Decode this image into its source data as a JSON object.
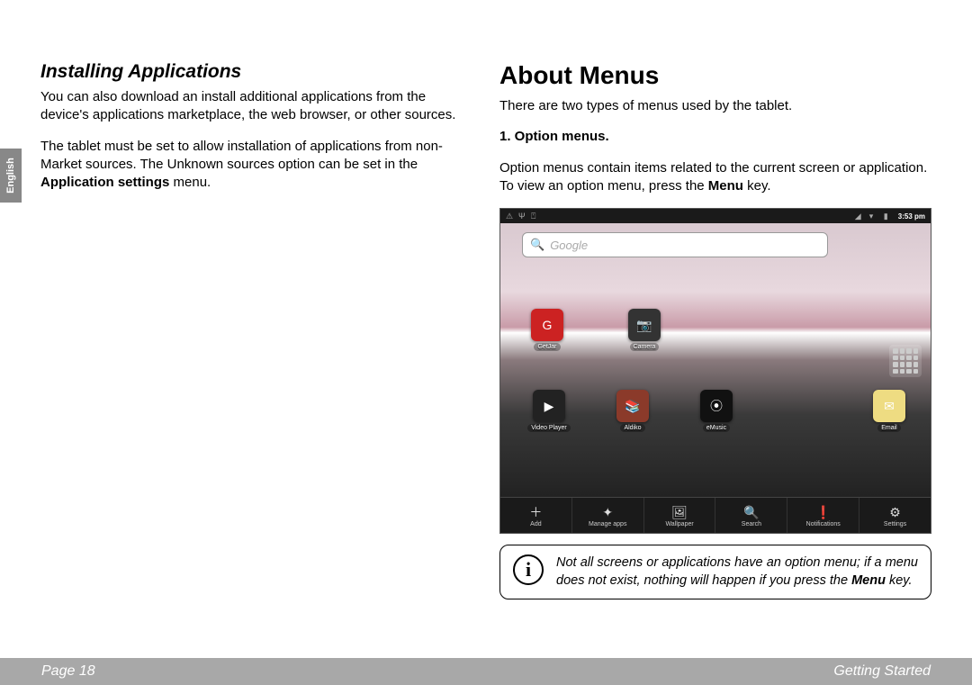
{
  "sideTab": "English",
  "left": {
    "heading": "Installing Applications",
    "p1": "You can also download an install additional applications from the device's applications marketplace, the web browser, or other sources.",
    "p2a": "The tablet must be set to allow installation of applications from non-Market sources. The Unknown sources option can be set in the ",
    "p2b": "Application settings",
    "p2c": " menu."
  },
  "right": {
    "title": "About Menus",
    "intro": "There are two types of menus used by the tablet.",
    "sub1": "1.    Option menus.",
    "p1a": "Option menus contain items related to the current screen or application. To view an option menu, press the ",
    "p1b": "Menu",
    "p1c": " key."
  },
  "screenshot": {
    "time": "3:53 pm",
    "searchPlaceholder": "Google",
    "apps": {
      "getjar": "GetJar",
      "camera": "Camera",
      "video": "Video Player",
      "aldiko": "Aldiko",
      "emusic": "eMusic",
      "email": "Email"
    },
    "menu": {
      "add": "Add",
      "manage": "Manage apps",
      "wallpaper": "Wallpaper",
      "search": "Search",
      "notifications": "Notifications",
      "settings": "Settings"
    }
  },
  "note": {
    "a": "Not all screens or applications have an option menu; if a menu does not exist, nothing will happen if you press the ",
    "b": "Menu",
    "c": " key."
  },
  "footer": {
    "page": "Page 18",
    "section": "Getting Started"
  }
}
